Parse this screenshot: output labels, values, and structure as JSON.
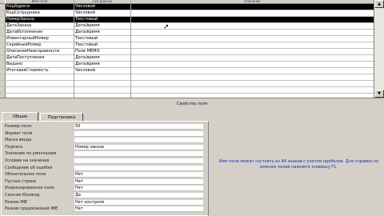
{
  "table": {
    "headers": [
      "Имя поля",
      "Тип данных",
      "Описание"
    ],
    "rows": [
      {
        "name": "КодАдреса",
        "type": "Числовой",
        "selected": true
      },
      {
        "name": "КодСотрудника",
        "type": "Числовой"
      },
      {
        "name": "НомерЗаказа",
        "type": "Текстовый",
        "selected": true
      },
      {
        "name": "ДатаЗаказа",
        "type": "Дата/время"
      },
      {
        "name": "ДатаИсполнения",
        "type": "Дата/время"
      },
      {
        "name": "ИнвентарныйНомер",
        "type": "Текстовый"
      },
      {
        "name": "СерийныйНомер",
        "type": "Текстовый"
      },
      {
        "name": "ОписаниеНеисправности",
        "type": "Поле MEMO"
      },
      {
        "name": "ДатаПоступления",
        "type": "Дата/время"
      },
      {
        "name": "Выдано",
        "type": "Дата/время"
      },
      {
        "name": "ИтоговаяСтоимость",
        "type": "Числовой"
      },
      {
        "name": "",
        "type": ""
      },
      {
        "name": "",
        "type": ""
      },
      {
        "name": "",
        "type": ""
      },
      {
        "name": "",
        "type": ""
      }
    ]
  },
  "section_title": "Свойства поля",
  "tabs": [
    "Общие",
    "Подстановка"
  ],
  "properties": [
    {
      "label": "Размер поля",
      "value": "50"
    },
    {
      "label": "Формат поля",
      "value": ""
    },
    {
      "label": "Маска ввода",
      "value": ""
    },
    {
      "label": "Подпись",
      "value": "Номер заказа"
    },
    {
      "label": "Значение по умолчанию",
      "value": ""
    },
    {
      "label": "Условие на значение",
      "value": ""
    },
    {
      "label": "Сообщение об ошибке",
      "value": ""
    },
    {
      "label": "Обязательное поле",
      "value": "Нет"
    },
    {
      "label": "Пустые строки",
      "value": "Нет"
    },
    {
      "label": "Индексированное поле",
      "value": "Нет"
    },
    {
      "label": "Сжатие Юникод",
      "value": "Да"
    },
    {
      "label": "Режим IME",
      "value": "Нет контроля"
    },
    {
      "label": "Режим предложений IME",
      "value": "Нет"
    }
  ],
  "help_text": "Имя поля может состоять из 64 знаков с учетом пробелов. Для справки по именам полей нажмите клавишу F1."
}
